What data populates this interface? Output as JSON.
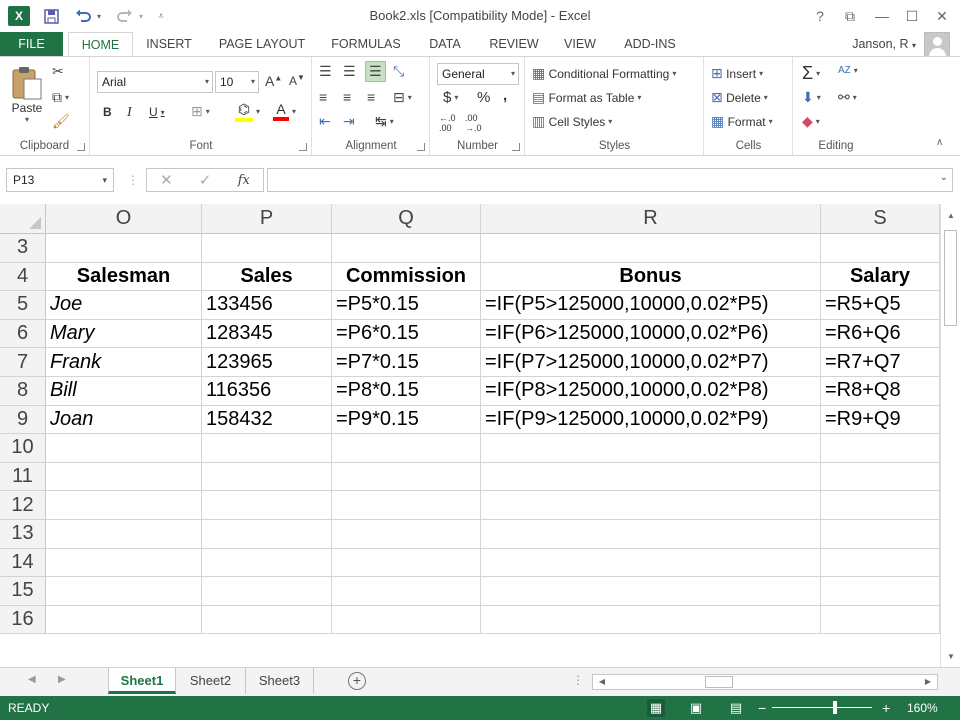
{
  "window": {
    "title": "Book2.xls  [Compatibility Mode] - Excel",
    "app_icon_label": "X",
    "controls": {
      "help": "?",
      "restore_ribbon": "⧉",
      "minimize": "—",
      "maximize": "☐",
      "close": "✕"
    }
  },
  "qat": {
    "save_icon": "save-icon",
    "undo_icon": "undo-icon",
    "redo_icon": "redo-icon"
  },
  "ribbon_tabs": [
    "FILE",
    "HOME",
    "INSERT",
    "PAGE LAYOUT",
    "FORMULAS",
    "DATA",
    "REVIEW",
    "VIEW",
    "ADD-INS"
  ],
  "active_tab": "HOME",
  "user": {
    "name": "Janson, R"
  },
  "ribbon": {
    "clipboard": {
      "label": "Clipboard",
      "paste": "Paste"
    },
    "font": {
      "label": "Font",
      "font_name": "Arial",
      "font_size": "10",
      "bold": "B",
      "italic": "I",
      "underline": "U"
    },
    "alignment": {
      "label": "Alignment"
    },
    "number": {
      "label": "Number",
      "format": "General",
      "currency": "$",
      "percent": "%",
      "comma": ","
    },
    "styles": {
      "label": "Styles",
      "conditional": "Conditional Formatting",
      "format_table": "Format as Table",
      "cell_styles": "Cell Styles"
    },
    "cells": {
      "label": "Cells",
      "insert": "Insert",
      "delete": "Delete",
      "format": "Format"
    },
    "editing": {
      "label": "Editing",
      "autosum": "Σ",
      "sort": "AZ"
    }
  },
  "formula_bar": {
    "name_box": "P13",
    "fx": "fx",
    "cancel": "✕",
    "enter": "✓",
    "sep": "⋮",
    "content": ""
  },
  "columns": [
    "O",
    "P",
    "Q",
    "R",
    "S"
  ],
  "rows": [
    {
      "num": "3",
      "cells": [
        "",
        "",
        "",
        "",
        ""
      ]
    },
    {
      "num": "4",
      "cells": [
        "Salesman",
        "Sales",
        "Commission",
        "Bonus",
        "Salary"
      ]
    },
    {
      "num": "5",
      "cells": [
        "Joe",
        "133456",
        "=P5*0.15",
        "=IF(P5>125000,10000,0.02*P5)",
        "=R5+Q5"
      ]
    },
    {
      "num": "6",
      "cells": [
        "Mary",
        "128345",
        "=P6*0.15",
        "=IF(P6>125000,10000,0.02*P6)",
        "=R6+Q6"
      ]
    },
    {
      "num": "7",
      "cells": [
        "Frank",
        "123965",
        "=P7*0.15",
        "=IF(P7>125000,10000,0.02*P7)",
        "=R7+Q7"
      ]
    },
    {
      "num": "8",
      "cells": [
        "Bill",
        "116356",
        "=P8*0.15",
        "=IF(P8>125000,10000,0.02*P8)",
        "=R8+Q8"
      ]
    },
    {
      "num": "9",
      "cells": [
        "Joan",
        "158432",
        "=P9*0.15",
        "=IF(P9>125000,10000,0.02*P9)",
        "=R9+Q9"
      ]
    },
    {
      "num": "10",
      "cells": [
        "",
        "",
        "",
        "",
        ""
      ]
    },
    {
      "num": "11",
      "cells": [
        "",
        "",
        "",
        "",
        ""
      ]
    },
    {
      "num": "12",
      "cells": [
        "",
        "",
        "",
        "",
        ""
      ]
    },
    {
      "num": "13",
      "cells": [
        "",
        "",
        "",
        "",
        ""
      ]
    },
    {
      "num": "14",
      "cells": [
        "",
        "",
        "",
        "",
        ""
      ]
    },
    {
      "num": "15",
      "cells": [
        "",
        "",
        "",
        "",
        ""
      ]
    },
    {
      "num": "16",
      "cells": [
        "",
        "",
        "",
        "",
        ""
      ]
    }
  ],
  "sheets": [
    "Sheet1",
    "Sheet2",
    "Sheet3"
  ],
  "active_sheet": "Sheet1",
  "status": {
    "mode": "READY",
    "zoom": "160%",
    "zoom_minus": "−",
    "zoom_plus": "+"
  },
  "colors": {
    "excel_green": "#217346",
    "status_green": "#217346"
  }
}
